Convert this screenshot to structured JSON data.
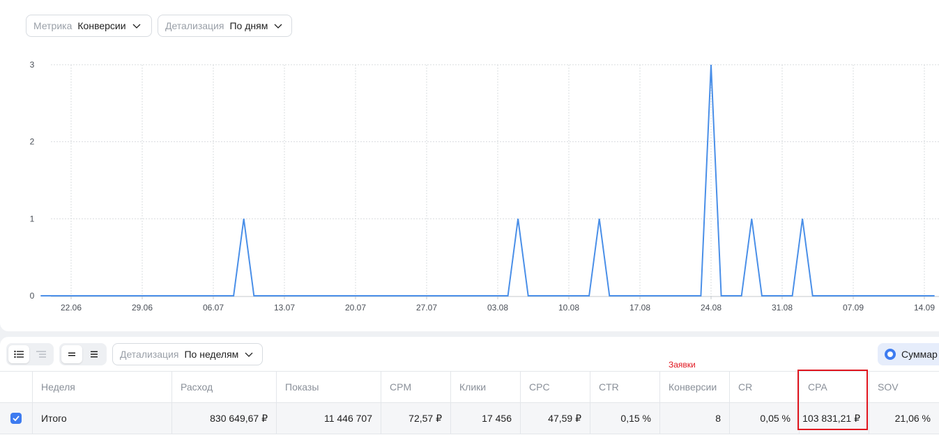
{
  "filters": {
    "metric": {
      "label": "Метрика",
      "value": "Конверсии"
    },
    "detail": {
      "label": "Детализация",
      "value": "По дням"
    }
  },
  "chart_data": {
    "type": "line",
    "title": "",
    "xlabel": "",
    "ylabel": "",
    "ylim": [
      0,
      3
    ],
    "y_ticks": [
      "0",
      "1",
      "2",
      "3"
    ],
    "x_ticks": [
      "22.06",
      "29.06",
      "06.07",
      "13.07",
      "20.07",
      "27.07",
      "03.08",
      "10.08",
      "17.08",
      "24.08",
      "31.08",
      "07.09",
      "14.09"
    ],
    "grid": true,
    "color": "#4a8fe8",
    "series": [
      {
        "name": "",
        "points": [
          [
            "2023-06-19",
            0
          ],
          [
            "2023-07-08",
            0
          ],
          [
            "2023-07-09",
            1
          ],
          [
            "2023-07-10",
            0
          ],
          [
            "2023-08-04",
            0
          ],
          [
            "2023-08-05",
            1
          ],
          [
            "2023-08-06",
            0
          ],
          [
            "2023-08-12",
            0
          ],
          [
            "2023-08-13",
            1
          ],
          [
            "2023-08-14",
            0
          ],
          [
            "2023-08-23",
            0
          ],
          [
            "2023-08-24",
            3
          ],
          [
            "2023-08-25",
            0
          ],
          [
            "2023-08-27",
            0
          ],
          [
            "2023-08-28",
            1
          ],
          [
            "2023-08-29",
            0
          ],
          [
            "2023-09-01",
            0
          ],
          [
            "2023-09-02",
            1
          ],
          [
            "2023-09-03",
            0
          ],
          [
            "2023-09-15",
            0
          ]
        ]
      }
    ]
  },
  "table_toolbar": {
    "detail": {
      "label": "Детализация",
      "value": "По неделям"
    },
    "summary_button": "Суммар"
  },
  "annotation": {
    "label": "Заявки"
  },
  "table": {
    "headers": [
      "Неделя",
      "Расход",
      "Показы",
      "CPM",
      "Клики",
      "CPC",
      "CTR",
      "Конверсии",
      "CR",
      "CPA",
      "SOV"
    ],
    "total_row": [
      "Итого",
      "830 649,67 ₽",
      "11 446 707",
      "72,57 ₽",
      "17 456",
      "47,59 ₽",
      "0,15 %",
      "8",
      "0,05 %",
      "103 831,21 ₽",
      "21,06 %"
    ]
  }
}
